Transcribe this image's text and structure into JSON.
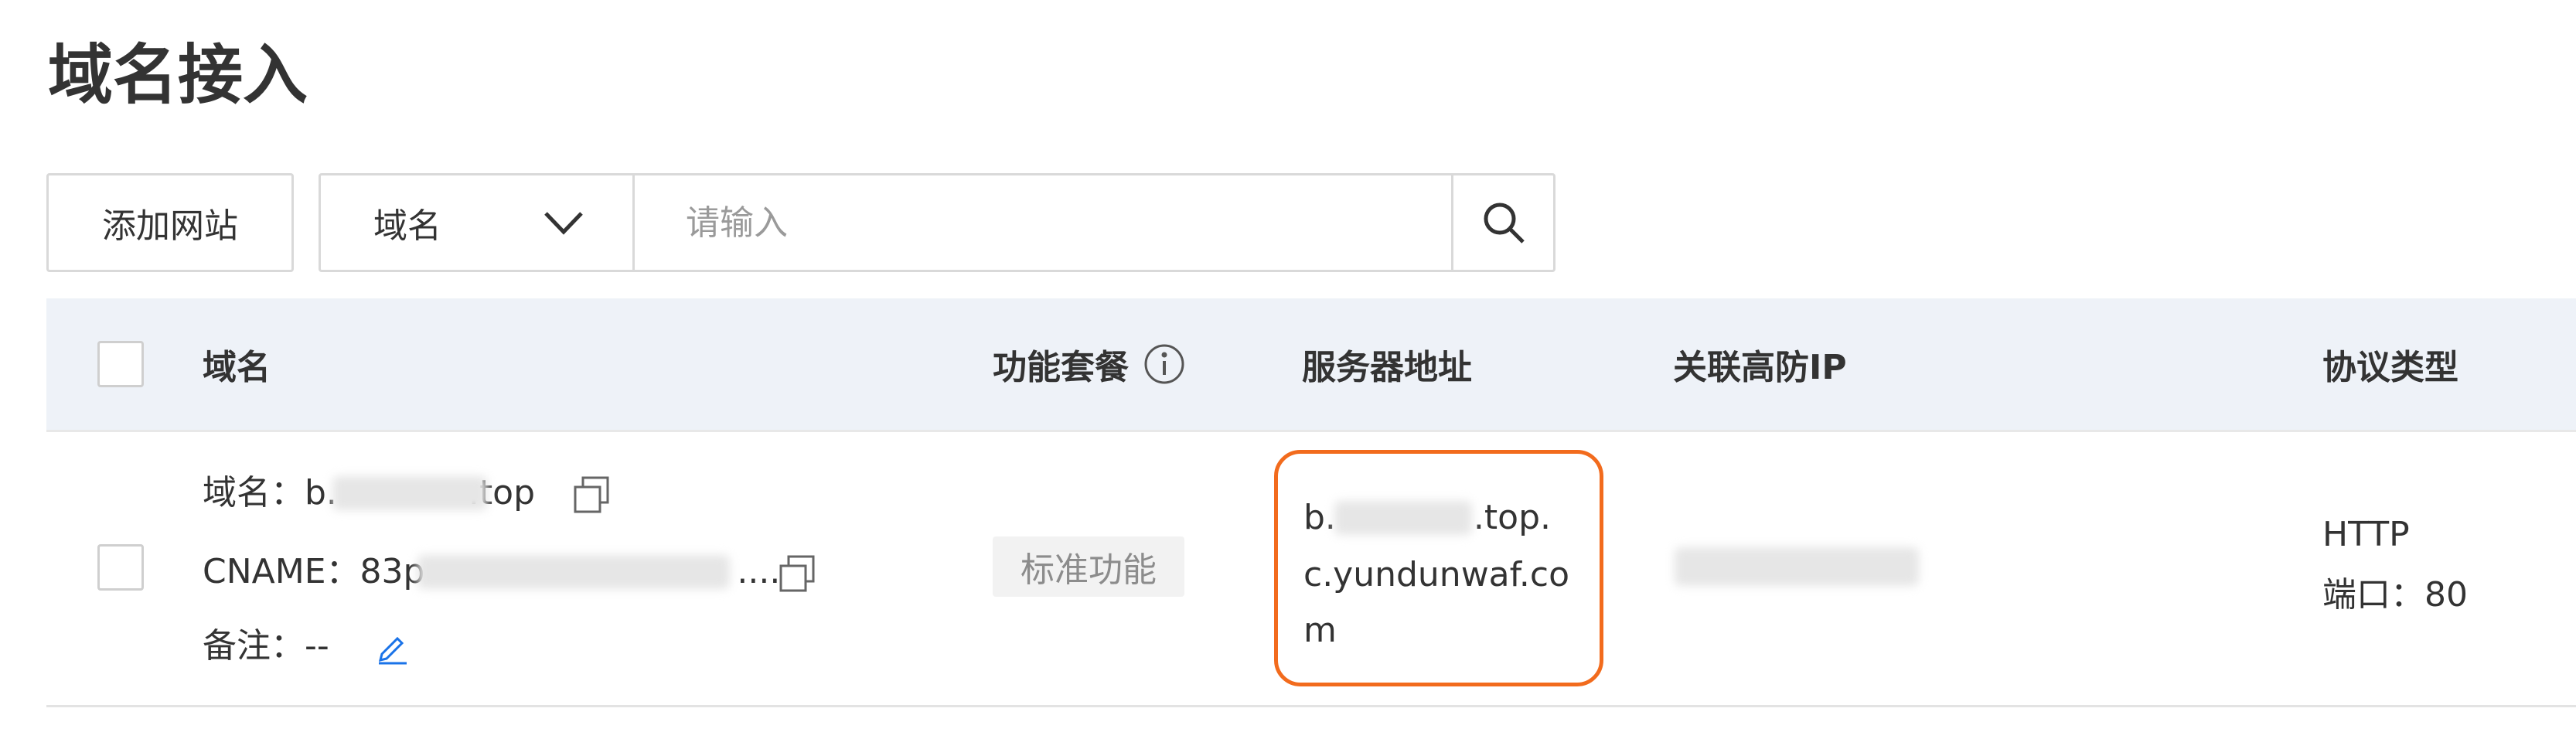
{
  "page": {
    "title": "域名接入"
  },
  "toolbar": {
    "add_label": "添加网站",
    "search_field": {
      "selected": "域名",
      "placeholder": "请输入"
    }
  },
  "table": {
    "columns": [
      "域名",
      "功能套餐",
      "服务器地址",
      "关联高防IP",
      "协议类型"
    ],
    "rows": [
      {
        "domain_prefix": "域名：",
        "domain_start": "b.",
        "domain_end": ".top",
        "cname_prefix": "CNAME：",
        "cname_start": "83p",
        "cname_end": "....",
        "remark_prefix": "备注：",
        "remark_value": "--",
        "plan": "标准功能",
        "server_line1_start": "b.",
        "server_line1_end": ".top.",
        "server_line2": "c.yundunwaf.co",
        "server_line3": "m",
        "protocol": "HTTP",
        "port_label": "端口：",
        "port_value": "80"
      }
    ]
  },
  "colors": {
    "highlight_border": "#f26b1d",
    "header_bg": "#eef2f8",
    "edit_icon": "#1a73e8"
  }
}
